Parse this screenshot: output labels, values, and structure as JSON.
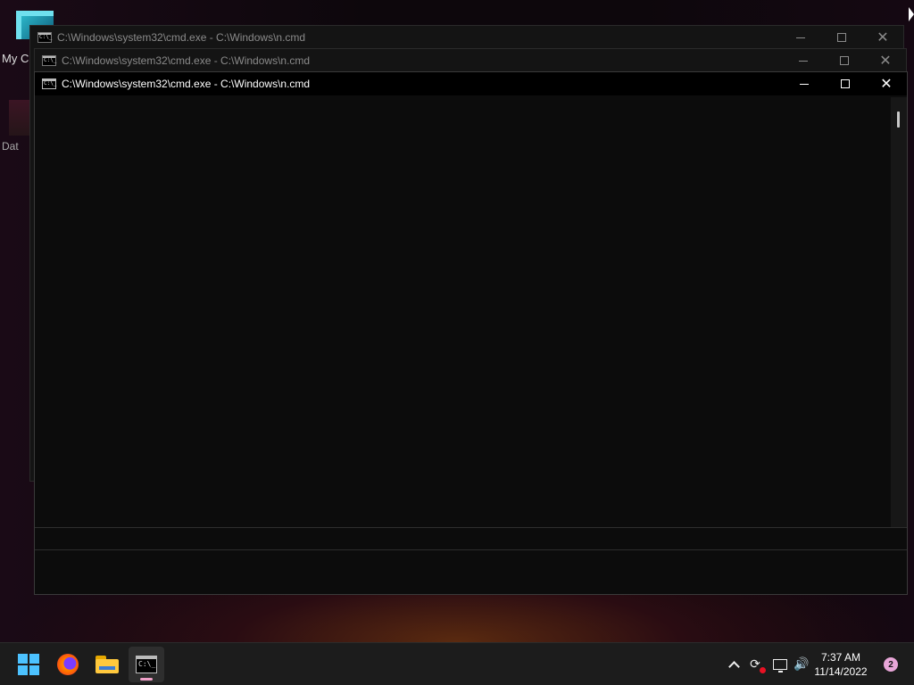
{
  "desktop": {
    "icon1_label": "My C",
    "icon2_label": "Dat"
  },
  "windows": [
    {
      "title": "C:\\Windows\\system32\\cmd.exe - C:\\Windows\\n.cmd",
      "icon_text": "C:\\_"
    },
    {
      "title": "C:\\Windows\\system32\\cmd.exe - C:\\Windows\\n.cmd",
      "icon_text": "C:\\_"
    },
    {
      "title": "C:\\Windows\\system32\\cmd.exe - C:\\Windows\\n.cmd",
      "icon_text": "C:\\_"
    }
  ],
  "taskbar": {
    "cmd_icon_text": "C:\\_",
    "time": "7:37 AM",
    "date": "11/14/2022",
    "notification_count": "2"
  },
  "icons": {
    "start": "windows-start-icon",
    "browser": "firefox-icon",
    "explorer": "file-explorer-icon",
    "terminal": "command-prompt-icon",
    "tray_chevron": "show-hidden-icons-chevron",
    "sync": "sync-icon",
    "network": "network-icon",
    "volume": "volume-icon"
  },
  "colors": {
    "start_blue": "#4cc2ff",
    "active_indicator": "#f0a0c8",
    "notification_badge": "#e8a6d8",
    "sync_alert": "#e81123"
  }
}
